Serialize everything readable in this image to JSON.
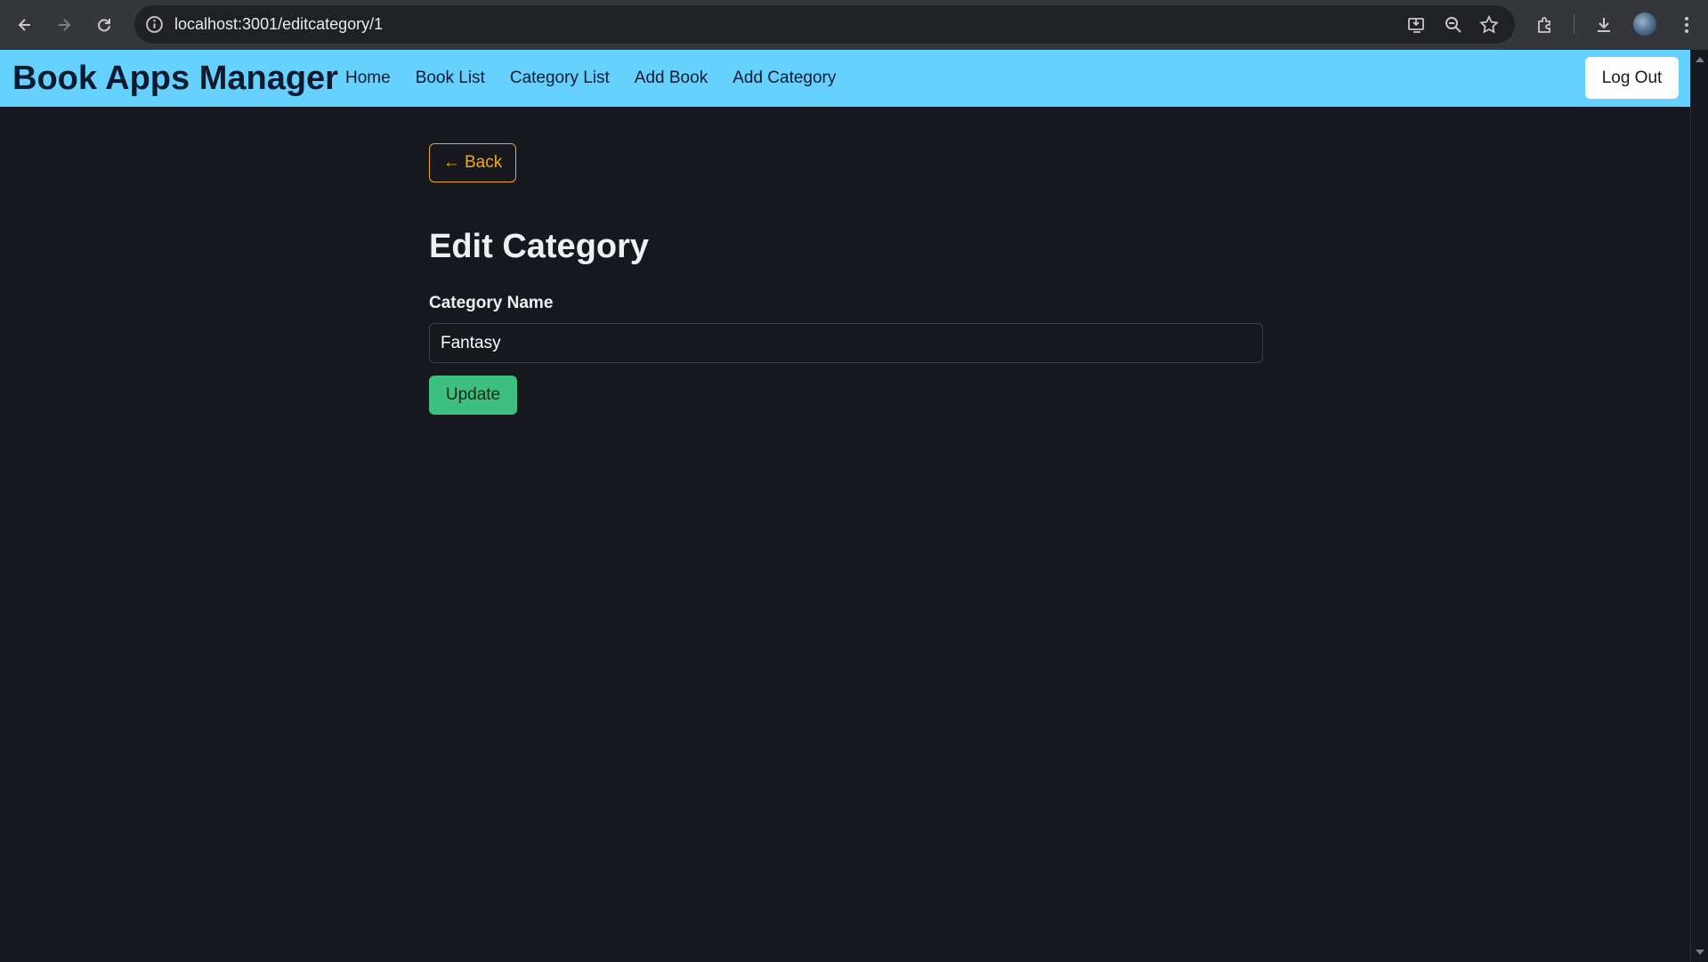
{
  "browser": {
    "url": "localhost:3001/editcategory/1"
  },
  "navbar": {
    "brand": "Book Apps Manager",
    "links": [
      "Home",
      "Book List",
      "Category List",
      "Add Book",
      "Add Category"
    ],
    "logout_label": "Log Out"
  },
  "main": {
    "back_label": "← Back",
    "title": "Edit Category",
    "field_label": "Category Name",
    "field_value": "Fantasy",
    "submit_label": "Update"
  },
  "colors": {
    "navbar_bg": "#66d1ff",
    "page_bg": "#16181d",
    "back_accent": "#f0a81e",
    "update_bg": "#3cbf7f"
  },
  "icons": {
    "back": "arrow-left-icon",
    "forward": "arrow-right-icon",
    "reload": "reload-icon",
    "info": "info-icon",
    "install": "install-app-icon",
    "zoom": "zoom-icon",
    "bookmark": "star-icon",
    "extensions": "puzzle-icon",
    "download": "download-icon",
    "menu": "kebab-menu-icon"
  }
}
